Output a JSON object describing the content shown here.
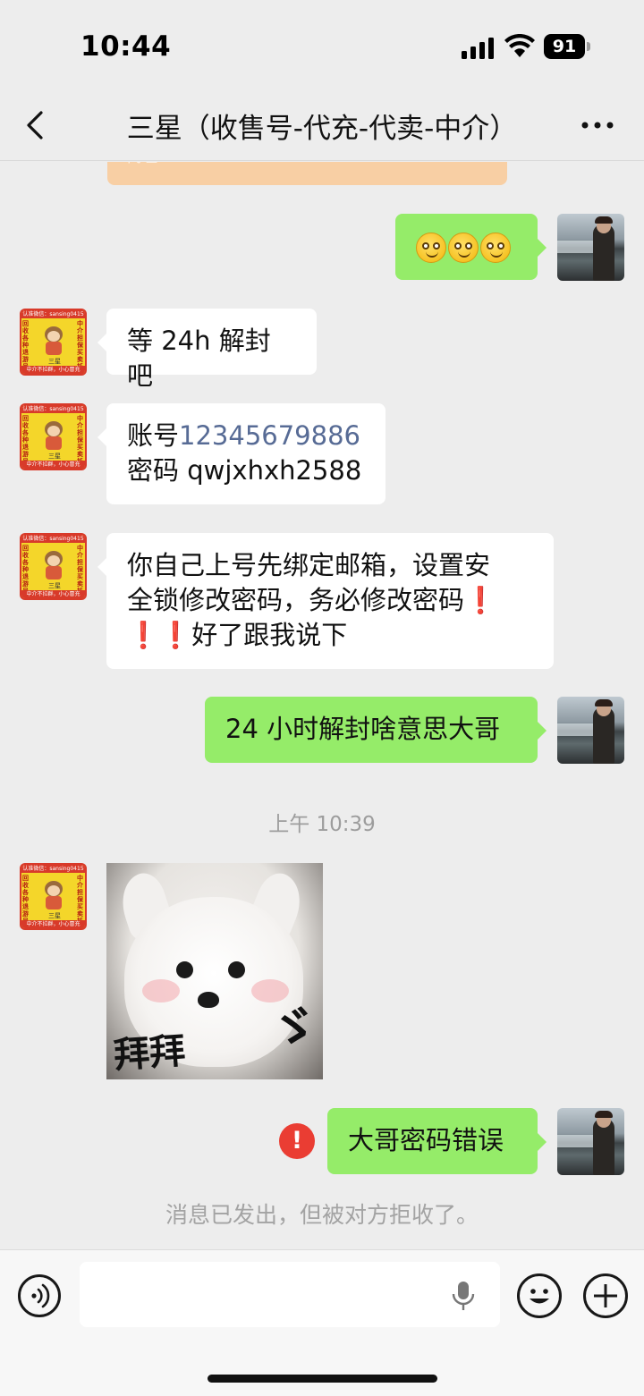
{
  "status_bar": {
    "time": "10:44",
    "battery": "91",
    "icons": [
      "signal-icon",
      "wifi-icon",
      "battery-icon"
    ]
  },
  "header": {
    "title": "三星（收售号-代充-代卖-中介）",
    "back_icon": "chevron-left-icon",
    "more_icon": "more-dots-icon"
  },
  "shop_avatar": {
    "top_strip": "认准微信：sansing0415",
    "left_text": "回收各种退游号",
    "right_text": "中介担保买卖抵押号",
    "bottom_strip": "中介不拉群，小心冒充",
    "name": "三星"
  },
  "messages": {
    "cut_off_text": "代理",
    "m1_emojis": [
      "smile-emoji",
      "smile-emoji",
      "smile-emoji"
    ],
    "m2_text": "等 24h 解封吧",
    "m3_label": "账号",
    "m3_account": "12345679886",
    "m3_password_line": "密码 qwjxhxh2588",
    "m4_line1": "你自己上号先绑定邮箱，设置安",
    "m4_line2": "全锁修改密码，务必修改密码",
    "m4_line3": "好了跟我说下",
    "m4_bang": "❗",
    "m5_text": "24 小时解封啥意思大哥",
    "timestamp": "上午 10:39",
    "sticker_caption": "拜拜",
    "sticker_mark": "ゞ",
    "m7_text": "大哥密码错误",
    "m7_error_mark": "!",
    "rejected_notice": "消息已发出，但被对方拒收了。"
  },
  "input_bar": {
    "text_value": "",
    "icons": [
      "voice-icon",
      "mic-icon",
      "emoji-icon",
      "plus-icon"
    ]
  },
  "colors": {
    "background": "#ededed",
    "sent_bubble": "#95ec69",
    "received_bubble": "#ffffff",
    "link_blue": "#576b95",
    "error_red": "#ea3d33",
    "cut_bubble": "#f8cfa4"
  }
}
